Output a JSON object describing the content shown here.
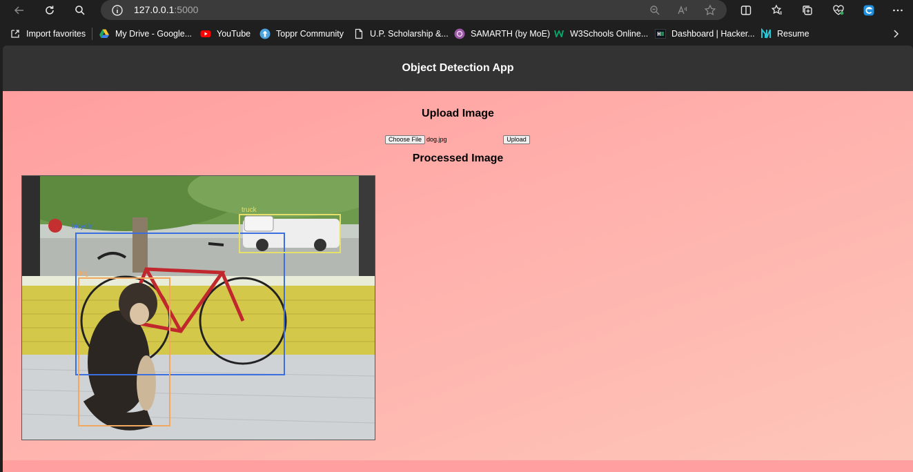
{
  "browser": {
    "url_host": "127.0.0.1",
    "url_port": ":5000",
    "bookmarks": [
      {
        "label": "Import favorites",
        "icon": "import-icon"
      },
      {
        "label": "My Drive - Google...",
        "icon": "google-drive-icon"
      },
      {
        "label": "YouTube",
        "icon": "youtube-icon"
      },
      {
        "label": "Toppr Community",
        "icon": "toppr-icon"
      },
      {
        "label": "U.P. Scholarship &...",
        "icon": "page-icon"
      },
      {
        "label": "SAMARTH (by MoE)",
        "icon": "samarth-icon"
      },
      {
        "label": "W3Schools Online...",
        "icon": "w3schools-icon"
      },
      {
        "label": "Dashboard | Hacker...",
        "icon": "hackerrank-icon"
      },
      {
        "label": "Resume",
        "icon": "resume-icon"
      }
    ]
  },
  "app": {
    "title": "Object Detection App",
    "upload_heading": "Upload Image",
    "choose_file_label": "Choose File",
    "file_name": "dog.jpg",
    "upload_button": "Upload",
    "processed_heading": "Processed Image",
    "detections": [
      {
        "label": "bicycle",
        "color": "#3b6fe0"
      },
      {
        "label": "truck",
        "color": "#e6e06a"
      },
      {
        "label": "dog",
        "color": "#f0a860"
      }
    ]
  },
  "colors": {
    "browser_bg": "#1f1f1f",
    "header_bg": "#333333",
    "page_gradient_start": "#ff9e9e",
    "page_gradient_end": "#fdc6b8"
  }
}
